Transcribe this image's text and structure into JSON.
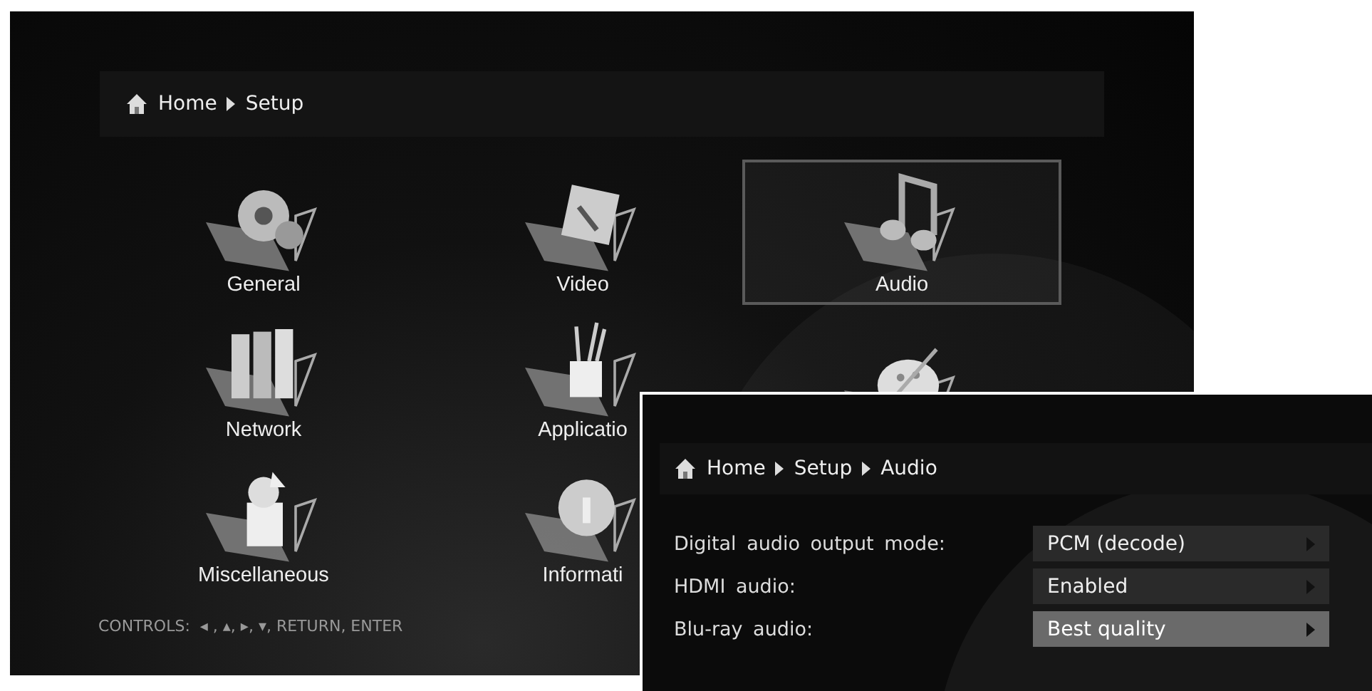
{
  "setup_screen": {
    "breadcrumb": [
      "Home",
      "Setup"
    ],
    "tiles": [
      {
        "kind": "gear",
        "label": "General",
        "selected": false
      },
      {
        "kind": "video",
        "label": "Video",
        "selected": false
      },
      {
        "kind": "music",
        "label": "Audio",
        "selected": true
      },
      {
        "kind": "network",
        "label": "Network",
        "selected": false
      },
      {
        "kind": "tools",
        "label": "Applicatio",
        "selected": false
      },
      {
        "kind": "palette",
        "selected": false
      },
      {
        "kind": "misc",
        "label": "Miscellaneous",
        "selected": false
      },
      {
        "kind": "info",
        "label": "Informati",
        "selected": false
      }
    ],
    "controls": "CONTROLS:  ◂ , ▴, ▸, ▾, RETURN, ENTER"
  },
  "audio_screen": {
    "breadcrumb": [
      "Home",
      "Setup",
      "Audio"
    ],
    "settings": [
      {
        "label": "Digital audio output mode:",
        "value": "PCM (decode)",
        "selected": false
      },
      {
        "label": "HDMI audio:",
        "value": "Enabled",
        "selected": false
      },
      {
        "label": "Blu-ray audio:",
        "value": "Best quality",
        "selected": true
      }
    ]
  }
}
